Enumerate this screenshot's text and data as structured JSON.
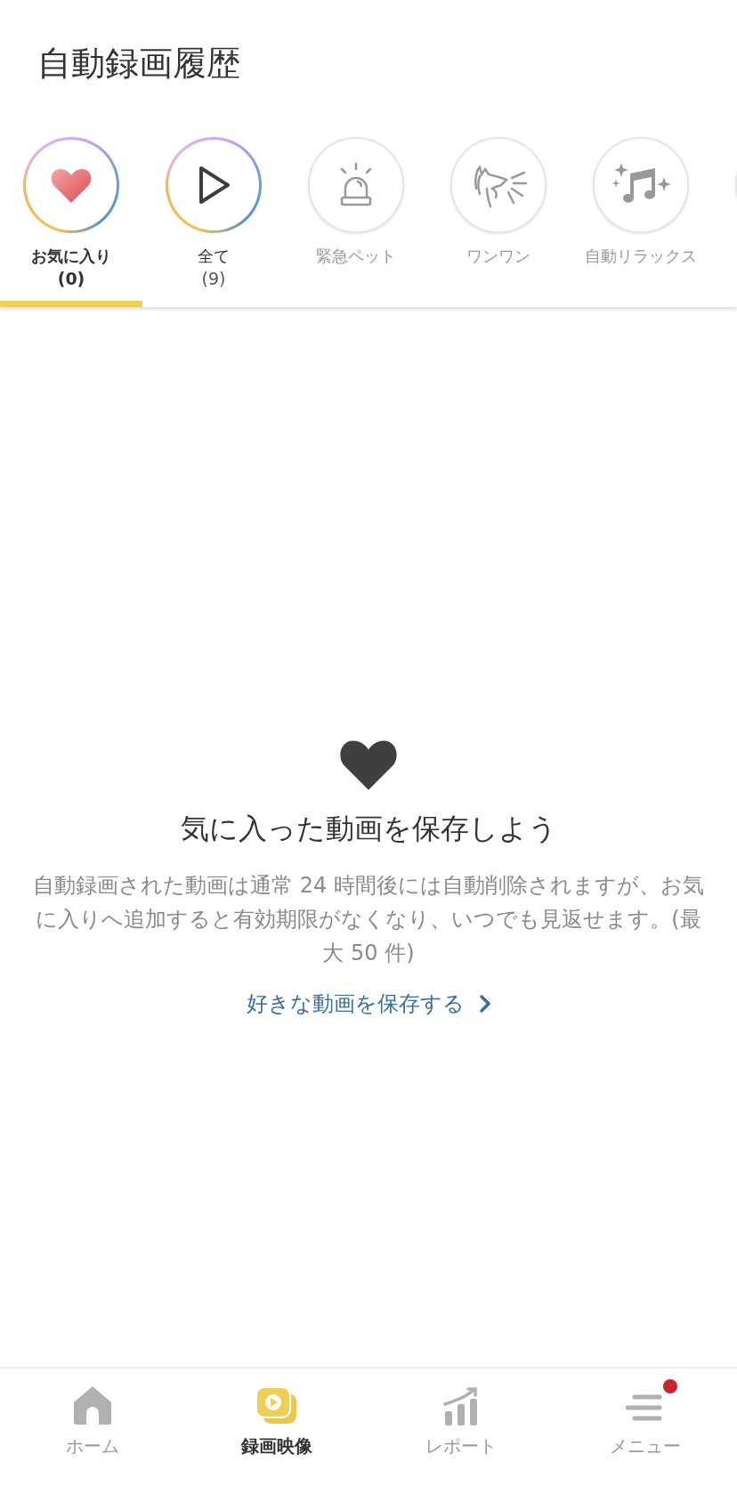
{
  "header": {
    "title": "自動録画履歴"
  },
  "tabs": [
    {
      "kind": "heart",
      "label": "お気に入り",
      "count": "(0)",
      "featured": true,
      "selected": true
    },
    {
      "kind": "play",
      "label": "全て",
      "count": "(9)",
      "featured": true,
      "selected": false
    },
    {
      "kind": "siren",
      "label": "緊急ペット",
      "featured": false,
      "selected": false
    },
    {
      "kind": "dog",
      "label": "ワンワン",
      "featured": false,
      "selected": false
    },
    {
      "kind": "music",
      "label": "自動リラックス",
      "featured": false,
      "selected": false
    }
  ],
  "empty_state": {
    "heading": "気に入った動画を保存しよう",
    "body": "自動録画された動画は通常 24 時間後には自動削除されますが、お気に入りへ追加すると有効期限がなくなり、いつでも見返せます。(最大 50 件)",
    "link": "好きな動画を保存する"
  },
  "bottom_nav": [
    {
      "kind": "home",
      "label": "ホーム",
      "selected": false,
      "badge": false
    },
    {
      "kind": "video",
      "label": "録画映像",
      "selected": true,
      "badge": false
    },
    {
      "kind": "report",
      "label": "レポート",
      "selected": false,
      "badge": false
    },
    {
      "kind": "menu",
      "label": "メニュー",
      "selected": false,
      "badge": true
    }
  ]
}
